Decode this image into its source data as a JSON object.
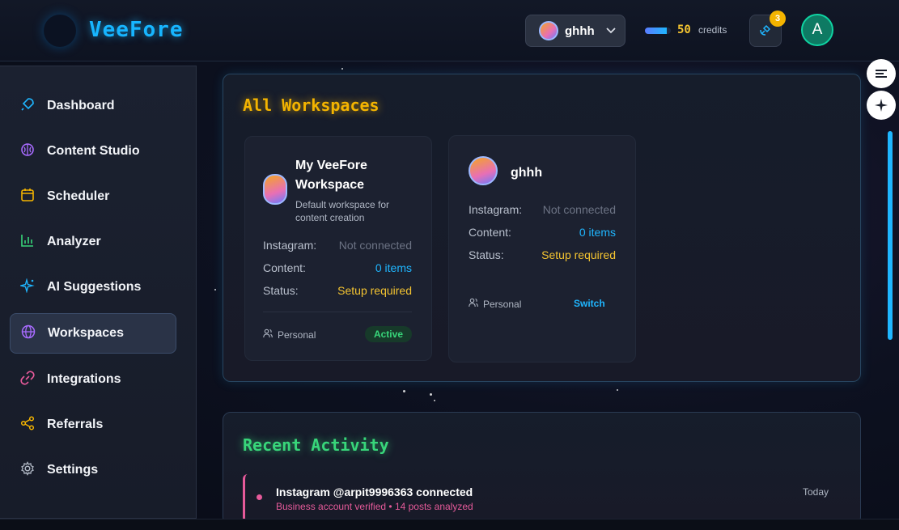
{
  "brand": {
    "name": "VeeFore"
  },
  "header": {
    "workspace_selector": {
      "name": "ghhh"
    },
    "credits": {
      "value": "50",
      "label": "credits",
      "fill_fraction": 0.85
    },
    "notifications": {
      "count": "3"
    },
    "user": {
      "initial": "A"
    }
  },
  "sidebar": {
    "items": [
      {
        "label": "Dashboard",
        "icon": "rocket-icon",
        "color": "#1fb6ff"
      },
      {
        "label": "Content Studio",
        "icon": "brain-icon",
        "color": "#a86bff"
      },
      {
        "label": "Scheduler",
        "icon": "calendar-icon",
        "color": "#f4b400"
      },
      {
        "label": "Analyzer",
        "icon": "bar-chart-icon",
        "color": "#38d67a"
      },
      {
        "label": "AI Suggestions",
        "icon": "sparkles-icon",
        "color": "#1fb6ff"
      },
      {
        "label": "Workspaces",
        "icon": "globe-icon",
        "color": "#a86bff",
        "active": true
      },
      {
        "label": "Integrations",
        "icon": "link-icon",
        "color": "#e65a9a"
      },
      {
        "label": "Referrals",
        "icon": "share-icon",
        "color": "#f4b400"
      },
      {
        "label": "Settings",
        "icon": "gear-icon",
        "color": "#b0b7c4"
      }
    ]
  },
  "workspaces_panel": {
    "title": "All Workspaces",
    "title_color": "#f4b400",
    "cards": [
      {
        "name_line1": "My VeeFore",
        "name_line2": "Workspace",
        "desc_line1": "Default workspace for",
        "desc_line2": "content creation",
        "instagram_label": "Instagram:",
        "instagram_value": "Not connected",
        "content_label": "Content:",
        "content_value": "0 items",
        "status_label": "Status:",
        "status_value": "Setup required",
        "type": "Personal",
        "badge": "Active"
      },
      {
        "name": "ghhh",
        "instagram_label": "Instagram:",
        "instagram_value": "Not connected",
        "content_label": "Content:",
        "content_value": "0 items",
        "status_label": "Status:",
        "status_value": "Setup required",
        "type": "Personal",
        "action": "Switch"
      }
    ]
  },
  "activity_panel": {
    "title": "Recent Activity",
    "title_color": "#38d67a",
    "items": [
      {
        "title": "Instagram @arpit9996363 connected",
        "subtitle": "Business account verified • 14 posts analyzed",
        "time": "Today"
      }
    ]
  },
  "floating_buttons": [
    {
      "icon": "quote-icon"
    },
    {
      "icon": "sparkle-icon"
    }
  ]
}
